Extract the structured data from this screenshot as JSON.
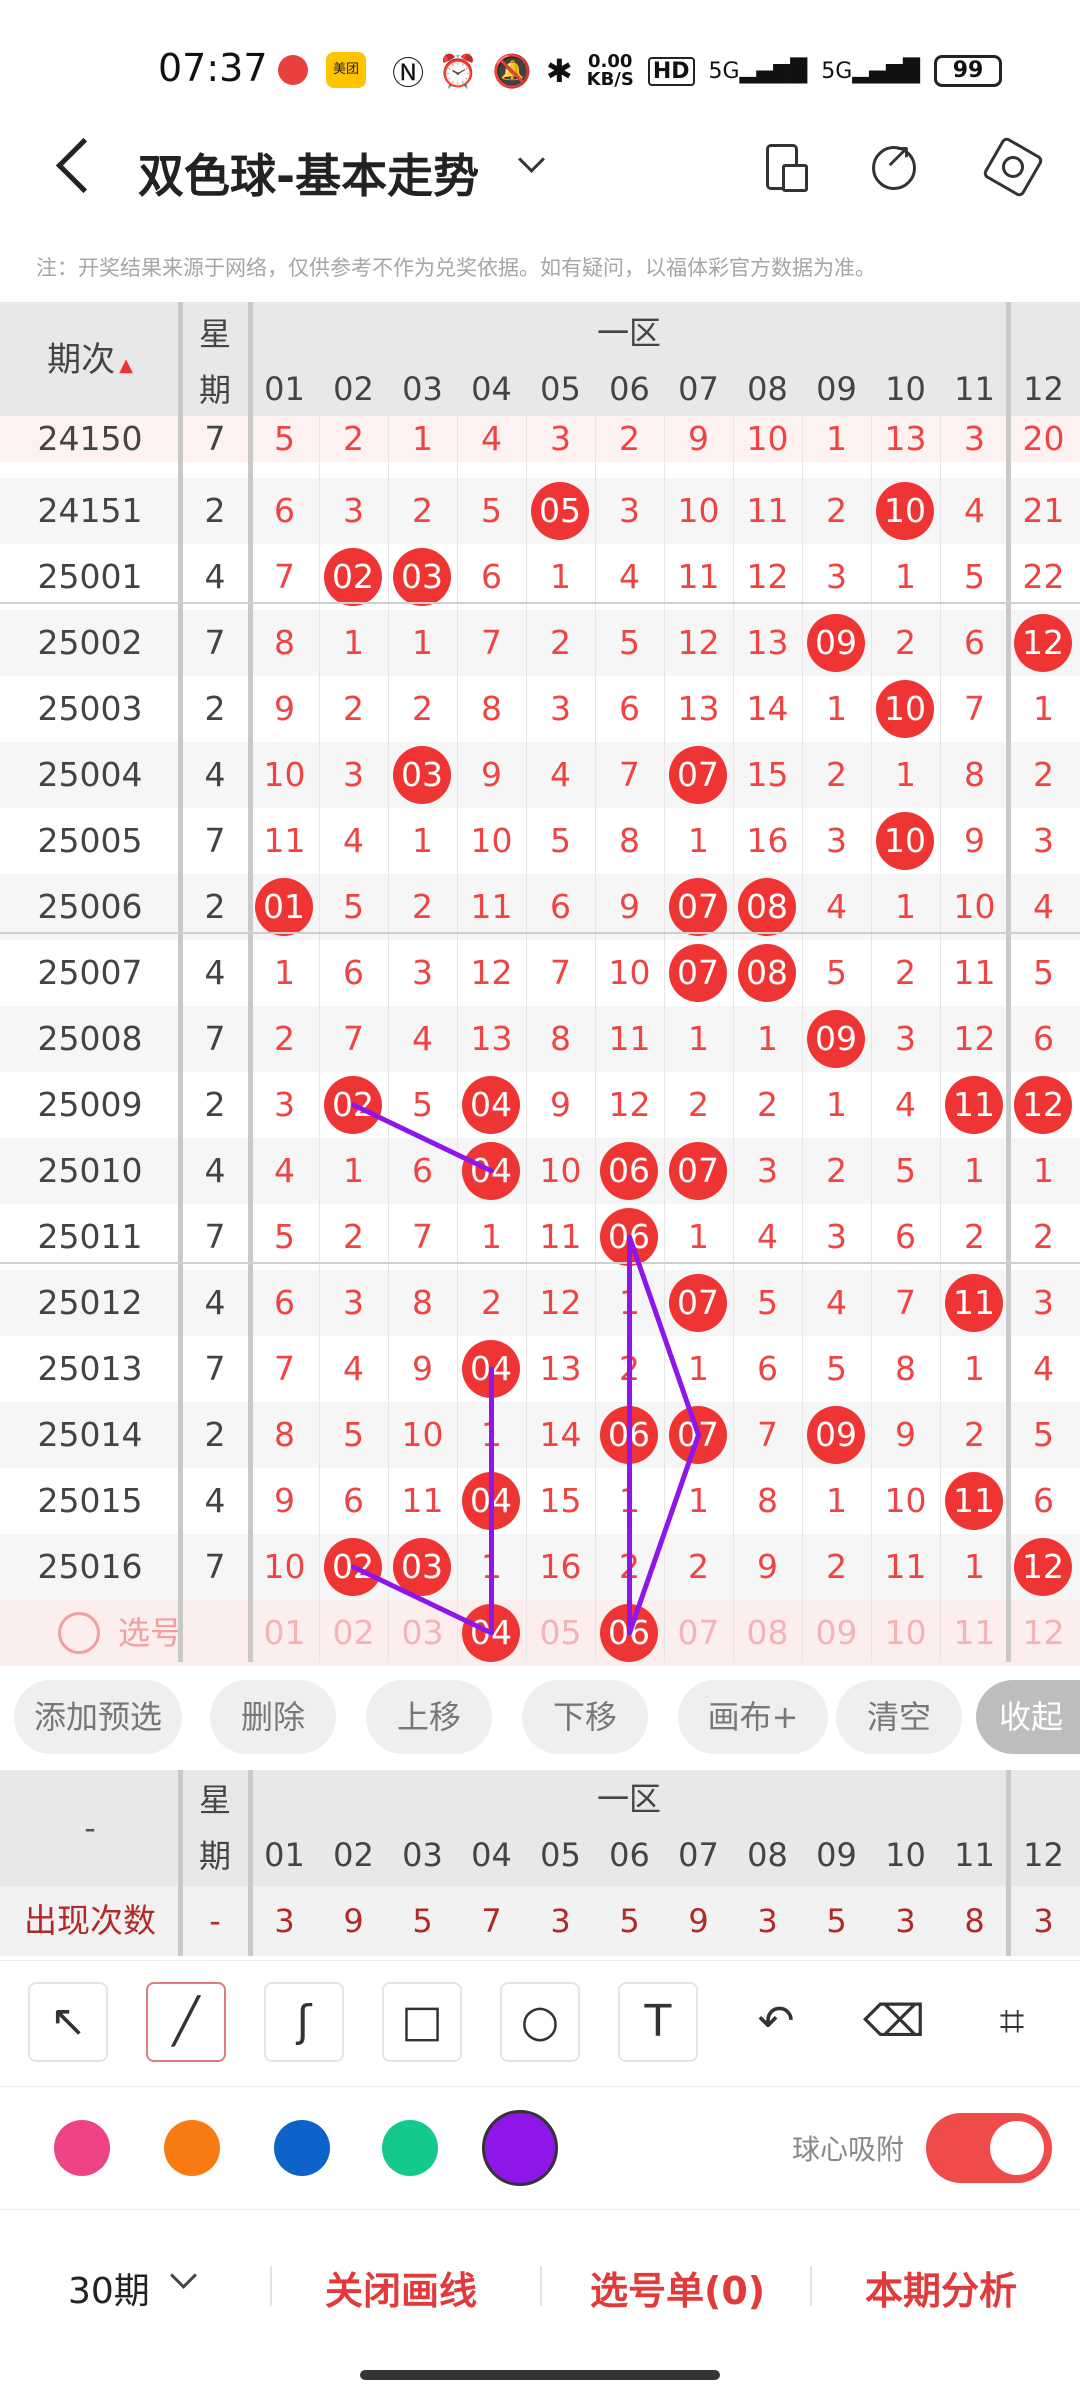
{
  "status": {
    "time": "07:37",
    "app2": "美团",
    "speed_top": "0.00",
    "speed_bot": "KB/S",
    "hd": "HD",
    "net1": "5G",
    "net2": "5G",
    "battery": "99"
  },
  "header": {
    "title": "双色球-基本走势"
  },
  "notice": "注：开奖结果来源于网络，仅供参考不作为兑奖依据。如有疑问，以福体彩官方数据为准。",
  "grid": {
    "col_issue": "期次",
    "col_week_1": "星",
    "col_week_2": "期",
    "zone": "一区",
    "numbers": [
      "01",
      "02",
      "03",
      "04",
      "05",
      "06",
      "07",
      "08",
      "09",
      "10",
      "11",
      "12"
    ],
    "rows": [
      {
        "issue": "24150",
        "week": "7",
        "cells": [
          "5",
          "2",
          "1",
          "4",
          "3",
          "2",
          "9",
          "10",
          "1",
          "13",
          "3",
          "20"
        ],
        "balls": []
      },
      {
        "issue": "24151",
        "week": "2",
        "cells": [
          "6",
          "3",
          "2",
          "5",
          "05",
          "3",
          "10",
          "11",
          "2",
          "10",
          "4",
          "21"
        ],
        "balls": [
          4,
          9
        ]
      },
      {
        "issue": "25001",
        "week": "4",
        "cells": [
          "7",
          "02",
          "03",
          "6",
          "1",
          "4",
          "11",
          "12",
          "3",
          "1",
          "5",
          "22"
        ],
        "balls": [
          1,
          2
        ]
      },
      {
        "issue": "25002",
        "week": "7",
        "cells": [
          "8",
          "1",
          "1",
          "7",
          "2",
          "5",
          "12",
          "13",
          "09",
          "2",
          "6",
          "12"
        ],
        "balls": [
          8,
          11
        ]
      },
      {
        "issue": "25003",
        "week": "2",
        "cells": [
          "9",
          "2",
          "2",
          "8",
          "3",
          "6",
          "13",
          "14",
          "1",
          "10",
          "7",
          "1"
        ],
        "balls": [
          9
        ]
      },
      {
        "issue": "25004",
        "week": "4",
        "cells": [
          "10",
          "3",
          "03",
          "9",
          "4",
          "7",
          "07",
          "15",
          "2",
          "1",
          "8",
          "2"
        ],
        "balls": [
          2,
          6
        ]
      },
      {
        "issue": "25005",
        "week": "7",
        "cells": [
          "11",
          "4",
          "1",
          "10",
          "5",
          "8",
          "1",
          "16",
          "3",
          "10",
          "9",
          "3"
        ],
        "balls": [
          9
        ]
      },
      {
        "issue": "25006",
        "week": "2",
        "cells": [
          "01",
          "5",
          "2",
          "11",
          "6",
          "9",
          "07",
          "08",
          "4",
          "1",
          "10",
          "4"
        ],
        "balls": [
          0,
          6,
          7
        ]
      },
      {
        "issue": "25007",
        "week": "4",
        "cells": [
          "1",
          "6",
          "3",
          "12",
          "7",
          "10",
          "07",
          "08",
          "5",
          "2",
          "11",
          "5"
        ],
        "balls": [
          6,
          7
        ]
      },
      {
        "issue": "25008",
        "week": "7",
        "cells": [
          "2",
          "7",
          "4",
          "13",
          "8",
          "11",
          "1",
          "1",
          "09",
          "3",
          "12",
          "6"
        ],
        "balls": [
          8
        ]
      },
      {
        "issue": "25009",
        "week": "2",
        "cells": [
          "3",
          "02",
          "5",
          "04",
          "9",
          "12",
          "2",
          "2",
          "1",
          "4",
          "11",
          "12"
        ],
        "balls": [
          1,
          3,
          10,
          11
        ]
      },
      {
        "issue": "25010",
        "week": "4",
        "cells": [
          "4",
          "1",
          "6",
          "04",
          "10",
          "06",
          "07",
          "3",
          "2",
          "5",
          "1",
          "1"
        ],
        "balls": [
          3,
          5,
          6
        ]
      },
      {
        "issue": "25011",
        "week": "7",
        "cells": [
          "5",
          "2",
          "7",
          "1",
          "11",
          "06",
          "1",
          "4",
          "3",
          "6",
          "2",
          "2"
        ],
        "balls": [
          5
        ]
      },
      {
        "issue": "25012",
        "week": "4",
        "cells": [
          "6",
          "3",
          "8",
          "2",
          "12",
          "1",
          "07",
          "5",
          "4",
          "7",
          "11",
          "3"
        ],
        "balls": [
          6,
          10
        ]
      },
      {
        "issue": "25013",
        "week": "7",
        "cells": [
          "7",
          "4",
          "9",
          "04",
          "13",
          "2",
          "1",
          "6",
          "5",
          "8",
          "1",
          "4"
        ],
        "balls": [
          3
        ]
      },
      {
        "issue": "25014",
        "week": "2",
        "cells": [
          "8",
          "5",
          "10",
          "1",
          "14",
          "06",
          "07",
          "7",
          "09",
          "9",
          "2",
          "5"
        ],
        "balls": [
          5,
          6,
          8
        ]
      },
      {
        "issue": "25015",
        "week": "4",
        "cells": [
          "9",
          "6",
          "11",
          "04",
          "15",
          "1",
          "1",
          "8",
          "1",
          "10",
          "11",
          "6"
        ],
        "balls": [
          3,
          10
        ]
      },
      {
        "issue": "25016",
        "week": "7",
        "cells": [
          "10",
          "02",
          "03",
          "1",
          "16",
          "2",
          "2",
          "9",
          "2",
          "11",
          "1",
          "12"
        ],
        "balls": [
          1,
          2,
          11
        ]
      }
    ],
    "select_label": "选号",
    "select_numbers": [
      "01",
      "02",
      "03",
      "04",
      "05",
      "06",
      "07",
      "08",
      "09",
      "10",
      "11",
      "12"
    ],
    "select_balls": [
      3,
      5
    ]
  },
  "actions": [
    "添加预选",
    "删除",
    "上移",
    "下移",
    "画布+",
    "清空"
  ],
  "collapse": "收起",
  "stats": {
    "left": "-",
    "week_1": "星",
    "week_2": "期",
    "zone": "一区",
    "numbers": [
      "01",
      "02",
      "03",
      "04",
      "05",
      "06",
      "07",
      "08",
      "09",
      "10",
      "11",
      "12"
    ],
    "label": "出现次数",
    "week_val": "-",
    "counts": [
      "3",
      "9",
      "5",
      "7",
      "3",
      "5",
      "9",
      "3",
      "5",
      "3",
      "8",
      "3"
    ]
  },
  "tools": [
    "arrow-icon",
    "line-icon",
    "curve-icon",
    "rectangle-icon",
    "circle-icon",
    "text-icon",
    "undo-icon",
    "eraser-icon",
    "clear-brush-icon"
  ],
  "colors": [
    "#ee4485",
    "#f77a12",
    "#0d63c9",
    "#13c98c",
    "#8e16e8"
  ],
  "snap_label": "球心吸附",
  "bottom": {
    "period": "30期",
    "close_lines": "关闭画线",
    "selection": "选号单(0)",
    "analysis": "本期分析"
  }
}
